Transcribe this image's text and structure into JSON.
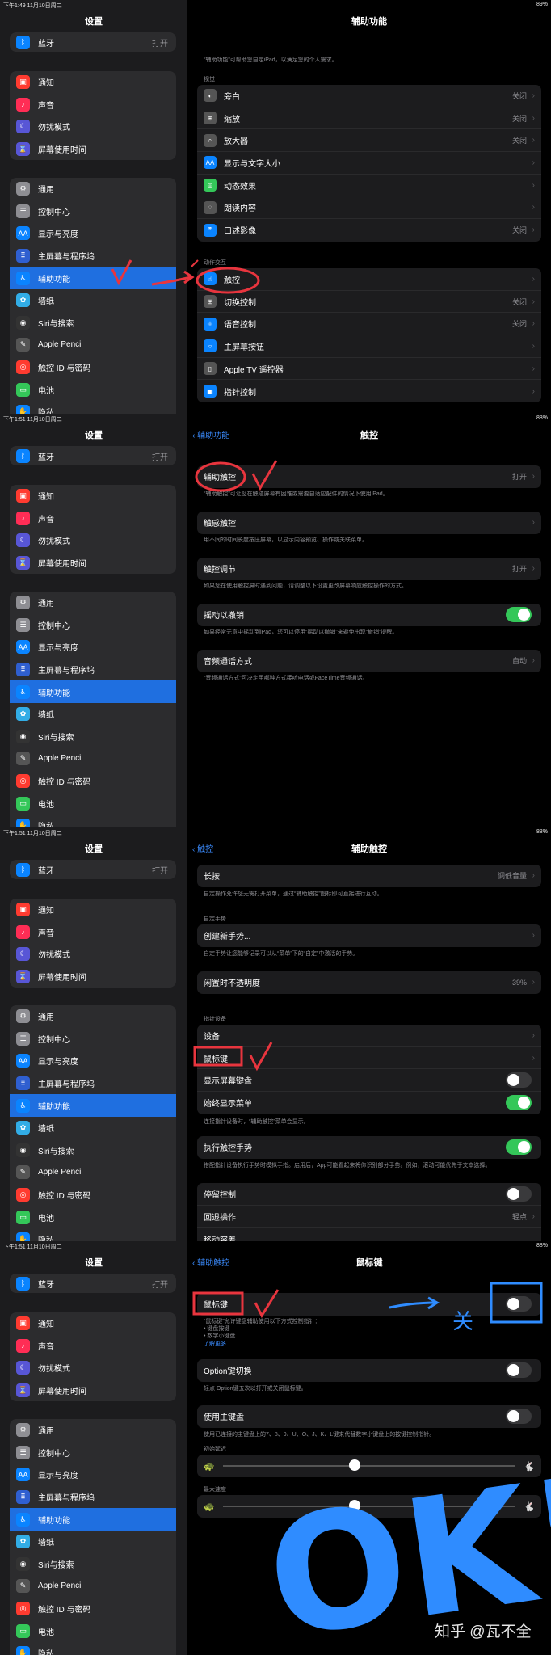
{
  "panels": [
    {
      "status": {
        "time": "下午1:49  11月10日周二",
        "battery": "89%"
      },
      "sidebar_title": "设置",
      "main_title": "辅助功能",
      "intro": "“辅助功能”可帮助您自定iPad，以满足您的个人需求。",
      "sec_vision": "视觉",
      "vision_rows": [
        {
          "label": "旁白",
          "value": "关闭"
        },
        {
          "label": "缩放",
          "value": "关闭"
        },
        {
          "label": "放大器",
          "value": "关闭"
        },
        {
          "label": "显示与文字大小",
          "value": ""
        },
        {
          "label": "动态效果",
          "value": ""
        },
        {
          "label": "朗读内容",
          "value": ""
        },
        {
          "label": "口述影像",
          "value": "关闭"
        }
      ],
      "sec_motor": "动作交互",
      "motor_rows": [
        {
          "label": "触控",
          "value": ""
        },
        {
          "label": "切换控制",
          "value": "关闭"
        },
        {
          "label": "语音控制",
          "value": "关闭"
        },
        {
          "label": "主屏幕按钮",
          "value": ""
        },
        {
          "label": "Apple TV 遥控器",
          "value": ""
        },
        {
          "label": "指针控制",
          "value": ""
        }
      ]
    },
    {
      "status": {
        "time": "下午1:51  11月10日周二",
        "battery": "88%"
      },
      "sidebar_title": "设置",
      "back": "辅助功能",
      "main_title": "触控",
      "row1": {
        "label": "辅助触控",
        "value": "打开"
      },
      "note1": "“辅助触控”可让您在触碰屏幕有困难或需要自适应配件的情况下使用iPad。",
      "row2": {
        "label": "触感触控"
      },
      "note2": "用不同的时间长度按压屏幕，以显示内容预览、操作或关联菜单。",
      "row3": {
        "label": "触控调节",
        "value": "打开"
      },
      "note3": "如果您在使用触控屏时遇到问题，请调整以下设置更改屏幕响应触控操作的方式。",
      "row4": {
        "label": "摇动以撤销"
      },
      "note4": "如果经常无意中摇动到iPad，您可以停用“摇动以撤销”来避免出现“撤销”提醒。",
      "row5": {
        "label": "音频通话方式",
        "value": "自动"
      },
      "note5": "“音频通话方式”可决定用哪种方式接听电话或FaceTime音频通话。"
    },
    {
      "status": {
        "time": "下午1:51  11月10日周二",
        "battery": "88%"
      },
      "sidebar_title": "设置",
      "back": "触控",
      "main_title": "辅助触控",
      "longpress": {
        "label": "长按",
        "value": "调低音量"
      },
      "note_longpress": "自定操作允许您无需打开菜单，通过“辅助触控”图标即可直接进行互动。",
      "sec_custom": "自定手势",
      "create": {
        "label": "创建新手势..."
      },
      "note_create": "自定手势让您能够记录可以从“菜单”下的“自定”中激活的手势。",
      "opacity": {
        "label": "闲置时不透明度",
        "value": "39%"
      },
      "sec_pointer": "指针设备",
      "pointer_rows": [
        {
          "label": "设备"
        },
        {
          "label": "鼠标键"
        },
        {
          "label": "显示屏幕键盘"
        },
        {
          "label": "始终显示菜单"
        }
      ],
      "note_pointer": "连接指针设备时，“辅助触控”菜单会显示。",
      "perform": {
        "label": "执行触控手势"
      },
      "note_perform": "搭配指针设备执行手势时模拟手指。启用后，App可能看起来将你识别部分手势。例如，滚动可能优先于文本选择。",
      "dwell_rows": [
        {
          "label": "停留控制",
          "value": ""
        },
        {
          "label": "回退操作",
          "value": "轻点"
        },
        {
          "label": "移动容差",
          "value": ""
        }
      ]
    },
    {
      "status": {
        "time": "下午1:51  11月10日周二",
        "battery": "88%"
      },
      "sidebar_title": "设置",
      "back": "辅助触控",
      "main_title": "鼠标键",
      "mousekeys": {
        "label": "鼠标键"
      },
      "note_mk": "“鼠标键”允许键盘辅助使用以下方式控制指针：",
      "note_mk_b1": "• 键盘按键",
      "note_mk_b2": "• 数字小键盘",
      "learn_more": "了解更多...",
      "option": {
        "label": "Option键切换"
      },
      "note_option": "轻点 Option键五次以打开或关闭鼠标键。",
      "mainkb": {
        "label": "使用主键盘"
      },
      "note_mainkb": "使用已连接的主键盘上的7、8、9、U、O、J、K、L键来代替数字小键盘上的按键控制指针。",
      "sec_delay": "初始延迟",
      "sec_speed": "最大速度",
      "delay_level": 0.45,
      "speed_level": 0.45
    }
  ],
  "sidebar": {
    "top": {
      "label": "蓝牙",
      "value": "打开"
    },
    "group2": [
      "通知",
      "声音",
      "勿扰模式",
      "屏幕使用时间"
    ],
    "group3": [
      "通用",
      "控制中心",
      "显示与亮度",
      "主屏幕与程序坞",
      "辅助功能",
      "墙纸",
      "Siri与搜索",
      "Apple Pencil",
      "触控 ID 与密码",
      "电池",
      "隐私"
    ]
  },
  "colors": {
    "accent": "#1f6fe0",
    "toggle_on": "#34c759",
    "annotation_red": "#e8353e",
    "annotation_blue": "#2f8cff"
  },
  "annotation_text": {
    "off": "关",
    "ok": "OK!"
  },
  "watermark": "知乎 @瓦不全"
}
